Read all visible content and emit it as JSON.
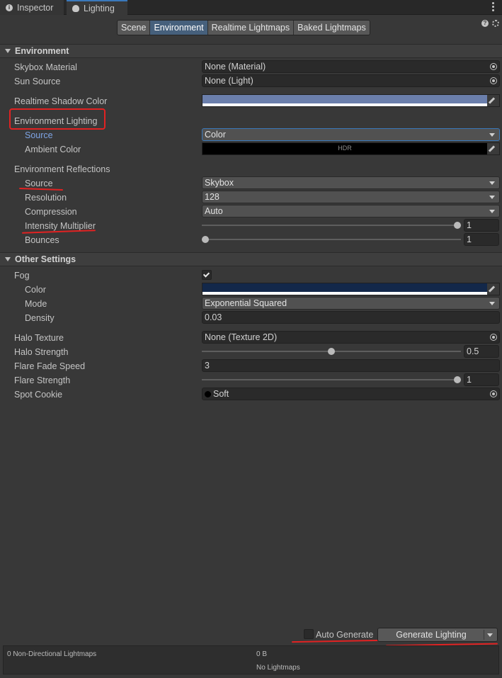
{
  "tabs": [
    {
      "label": "Inspector",
      "icon": "info-icon"
    },
    {
      "label": "Lighting",
      "icon": "lightbulb-icon"
    }
  ],
  "toolbar": {
    "segments": [
      "Scene",
      "Environment",
      "Realtime Lightmaps",
      "Baked Lightmaps"
    ],
    "active_segment": "Environment",
    "help_glyph": "?"
  },
  "environment": {
    "header": "Environment",
    "skybox_material": {
      "label": "Skybox Material",
      "value": "None (Material)"
    },
    "sun_source": {
      "label": "Sun Source",
      "value": "None (Light)"
    },
    "realtime_shadow_color": {
      "label": "Realtime Shadow Color",
      "color": "#6b7fac"
    },
    "environment_lighting": {
      "label": "Environment Lighting",
      "source": {
        "label": "Source",
        "value": "Color"
      },
      "ambient_color": {
        "label": "Ambient Color",
        "color": "#000000",
        "badge": "HDR"
      }
    },
    "environment_reflections": {
      "label": "Environment Reflections",
      "source": {
        "label": "Source",
        "value": "Skybox"
      },
      "resolution": {
        "label": "Resolution",
        "value": "128"
      },
      "compression": {
        "label": "Compression",
        "value": "Auto"
      },
      "intensity_multiplier": {
        "label": "Intensity Multiplier",
        "value": "1",
        "fraction": 1.0
      },
      "bounces": {
        "label": "Bounces",
        "value": "1",
        "fraction": 0.0
      }
    }
  },
  "other_settings": {
    "header": "Other Settings",
    "fog": {
      "label": "Fog",
      "checked": true
    },
    "fog_color": {
      "label": "Color",
      "color": "#13284a"
    },
    "fog_mode": {
      "label": "Mode",
      "value": "Exponential Squared"
    },
    "fog_density": {
      "label": "Density",
      "value": "0.03"
    },
    "halo_texture": {
      "label": "Halo Texture",
      "value": "None (Texture 2D)"
    },
    "halo_strength": {
      "label": "Halo Strength",
      "value": "0.5",
      "fraction": 0.5
    },
    "flare_fade_speed": {
      "label": "Flare Fade Speed",
      "value": "3"
    },
    "flare_strength": {
      "label": "Flare Strength",
      "value": "1",
      "fraction": 1.0
    },
    "spot_cookie": {
      "label": "Spot Cookie",
      "value": "Soft"
    }
  },
  "bottom": {
    "auto_generate": {
      "label": "Auto Generate",
      "checked": false
    },
    "generate_button": "Generate Lighting",
    "status_left": "0 Non-Directional Lightmaps",
    "status_size": "0 B",
    "status_note": "No Lightmaps"
  },
  "colors": {
    "annotation_red": "#e12222",
    "accent_blue": "#3a79bb",
    "active_segment": "#46607c"
  }
}
